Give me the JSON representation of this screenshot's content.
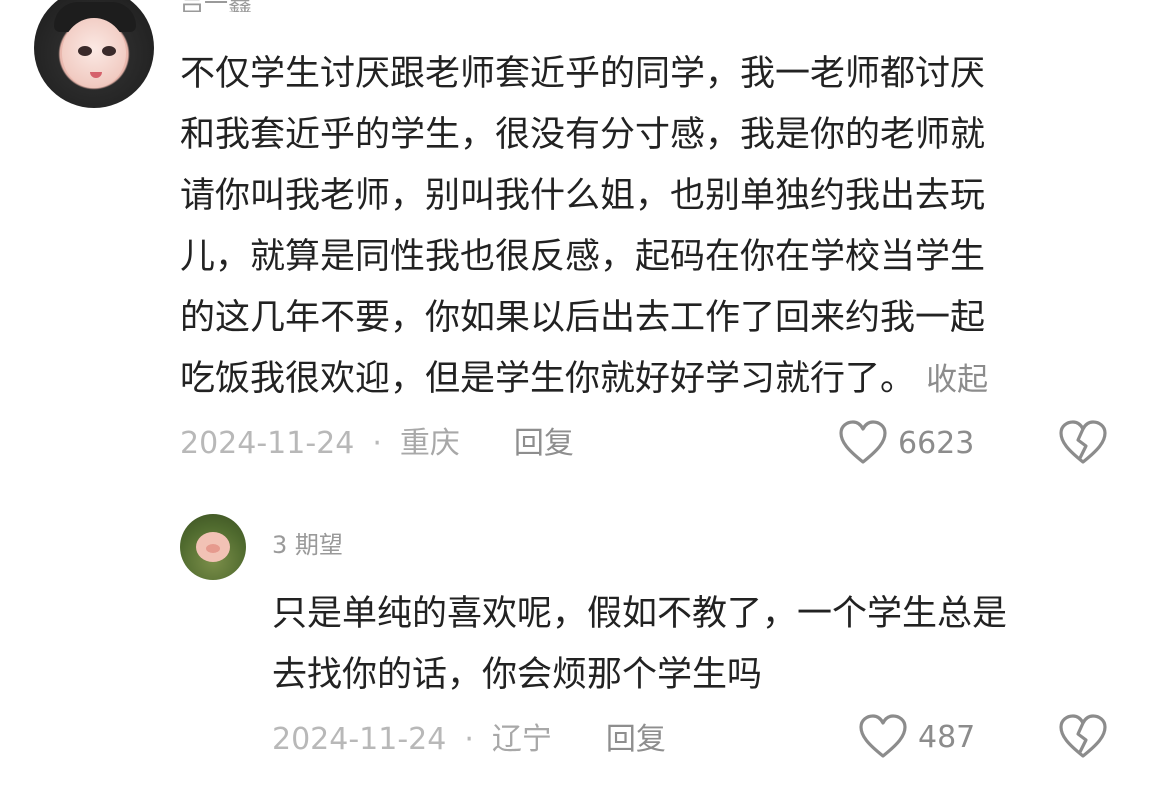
{
  "comments": [
    {
      "username": "吕一鑫",
      "text": "不仅学生讨厌跟老师套近乎的同学，我一老师都讨厌\n和我套近乎的学生，很没有分寸感，我是你的老师就\n请你叫我老师，别叫我什么姐，也别单独约我出去玩\n儿，就算是同性我也很反感，起码在你在学校当学生\n的这几年不要，你如果以后出去工作了回来约我一起\n吃饭我很欢迎，但是学生你就好好学习就行了。",
      "collapse_label": "收起",
      "date": "2024-11-24",
      "separator": "·",
      "location": "重庆",
      "reply_label": "回复",
      "likes": "6623",
      "icons": {
        "like": "heart-outline-icon",
        "dislike": "broken-heart-icon"
      }
    },
    {
      "username": "3 期望",
      "text": "只是单纯的喜欢呢，假如不教了，一个学生总是\n去找你的话，你会烦那个学生吗",
      "date": "2024-11-24",
      "separator": "·",
      "location": "辽宁",
      "reply_label": "回复",
      "likes": "487",
      "icons": {
        "like": "heart-outline-icon",
        "dislike": "broken-heart-icon"
      }
    }
  ],
  "colors": {
    "text": "#222222",
    "meta": "#a8a8a8",
    "icon": "#8c8c8c"
  }
}
